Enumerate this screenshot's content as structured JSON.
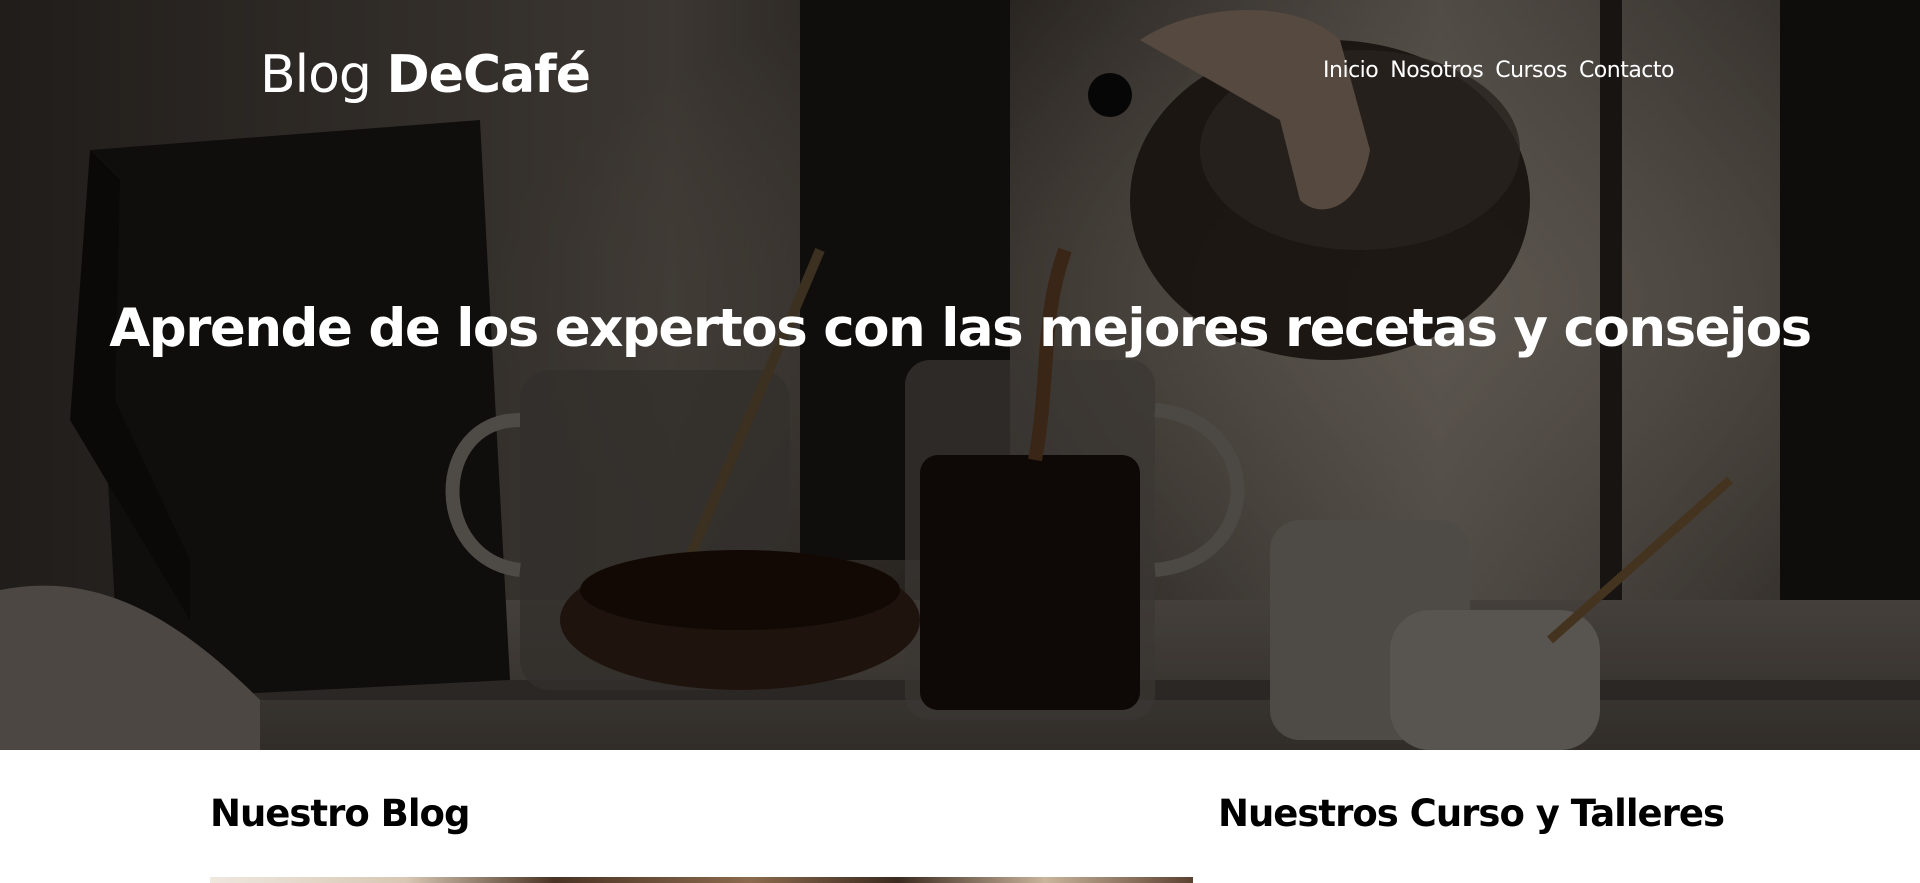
{
  "header": {
    "logo_light": "Blog ",
    "logo_bold": "DeCafé"
  },
  "nav": {
    "items": [
      "Inicio",
      "Nosotros",
      "Cursos",
      "Contacto"
    ]
  },
  "hero": {
    "title": "Aprende de los expertos con las mejores recetas y consejos"
  },
  "sections": {
    "blog_title": "Nuestro Blog",
    "courses_title": "Nuestros Curso y Talleres"
  },
  "colors": {
    "text_light": "#ffffff",
    "text_dark": "#000000",
    "overlay": "rgba(0,0,0,0.45)"
  }
}
